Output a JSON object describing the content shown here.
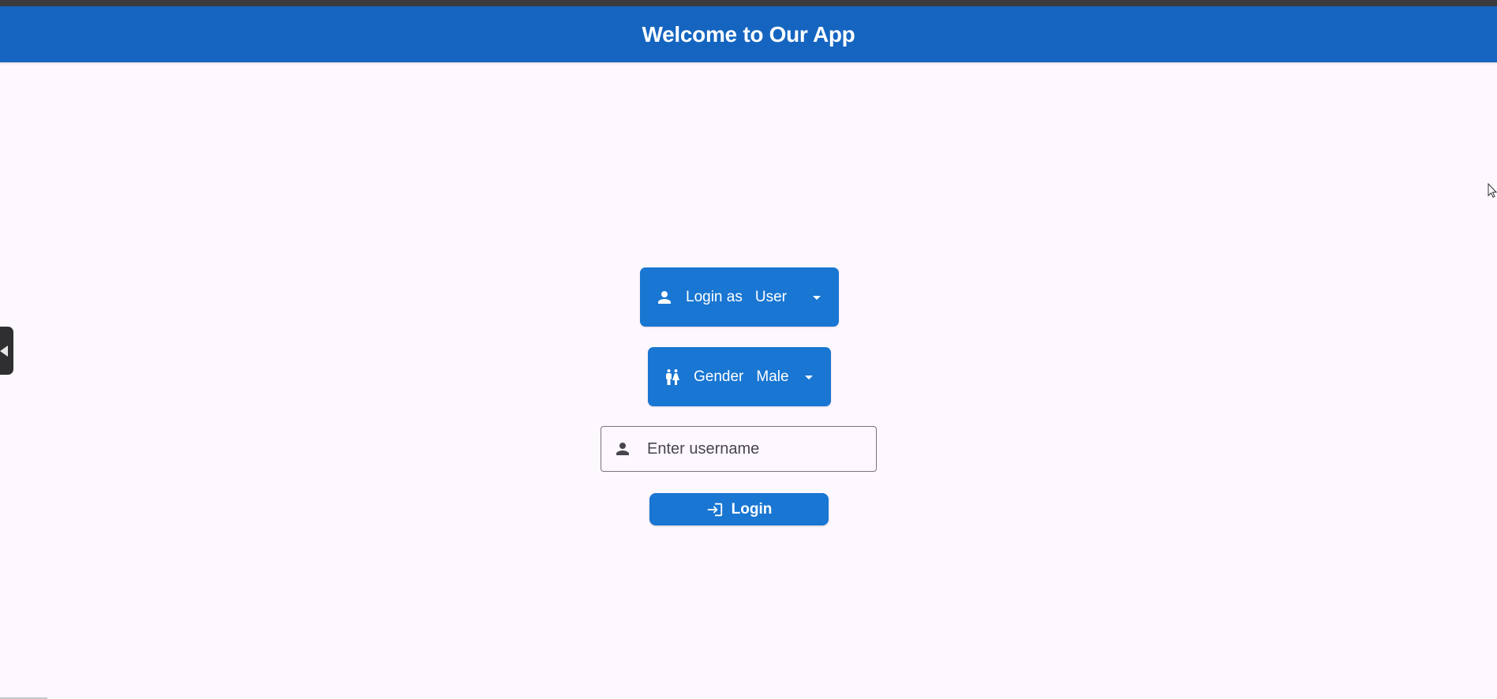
{
  "app": {
    "title": "Welcome to Our App"
  },
  "colors": {
    "appbar": "#1565c0",
    "primary": "#1976d2",
    "background": "#fdf7fe",
    "on_primary": "#ffffff"
  },
  "form": {
    "role_dropdown": {
      "label": "Login as",
      "value": "User",
      "icon": "person-icon"
    },
    "gender_dropdown": {
      "label": "Gender",
      "value": "Male",
      "icon": "wc-icon"
    },
    "username": {
      "placeholder": "Enter username",
      "value": "",
      "icon": "person-icon"
    },
    "login_button": {
      "label": "Login",
      "icon": "login-icon"
    }
  }
}
